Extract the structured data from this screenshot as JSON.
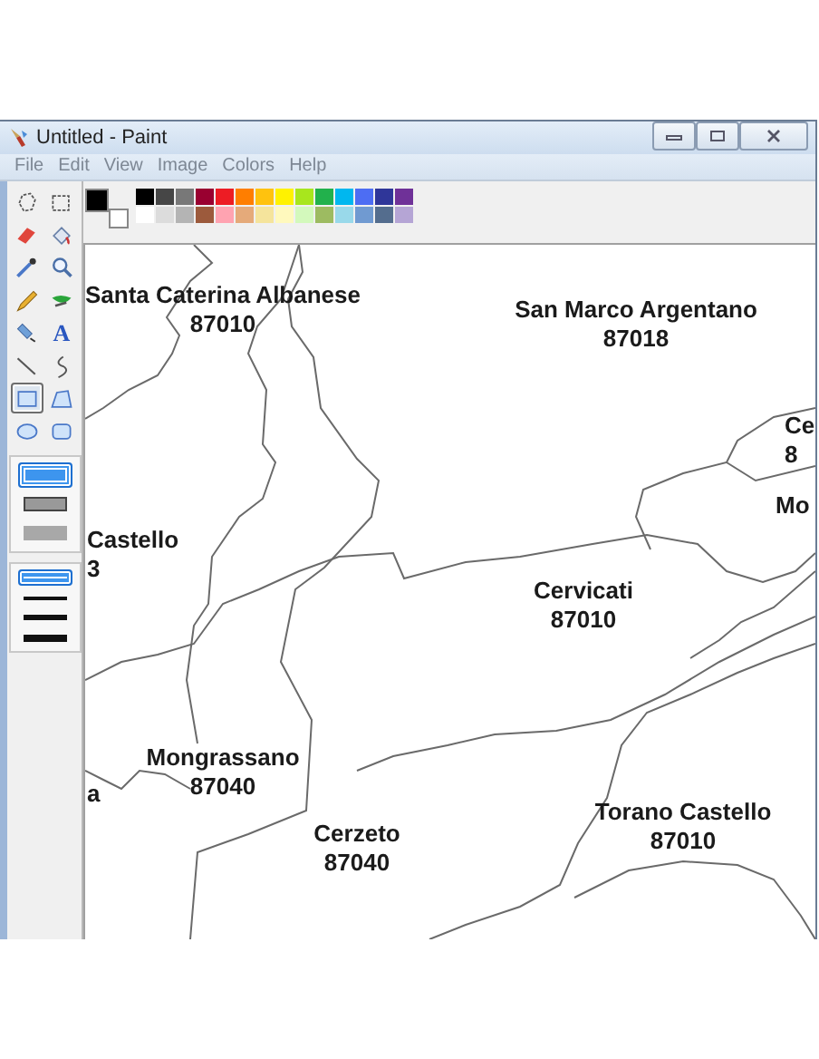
{
  "window": {
    "title": "Untitled - Paint"
  },
  "menu": [
    "File",
    "Edit",
    "View",
    "Image",
    "Colors",
    "Help"
  ],
  "tools": [
    {
      "kind": "free-select",
      "selected": false
    },
    {
      "kind": "select",
      "selected": false
    },
    {
      "kind": "eraser",
      "selected": false
    },
    {
      "kind": "fill",
      "selected": false
    },
    {
      "kind": "picker",
      "selected": false
    },
    {
      "kind": "magnifier",
      "selected": false
    },
    {
      "kind": "pencil",
      "selected": false
    },
    {
      "kind": "brush",
      "selected": false
    },
    {
      "kind": "airbrush",
      "selected": false
    },
    {
      "kind": "text",
      "glyph": "A",
      "selected": false
    },
    {
      "kind": "line",
      "selected": false
    },
    {
      "kind": "curve",
      "selected": false
    },
    {
      "kind": "rectangle",
      "selected": true
    },
    {
      "kind": "polygon",
      "selected": false
    },
    {
      "kind": "ellipse",
      "selected": false
    },
    {
      "kind": "rounded-rectangle",
      "selected": false
    }
  ],
  "fill_styles": [
    {
      "kind": "outline",
      "selected": true
    },
    {
      "kind": "outline-fill",
      "selected": false
    },
    {
      "kind": "fill",
      "selected": false
    }
  ],
  "line_widths": [
    {
      "kind": "thin",
      "selected": true
    },
    {
      "kind": "medium",
      "selected": false
    },
    {
      "kind": "thick",
      "selected": false
    },
    {
      "kind": "heavy",
      "selected": false
    }
  ],
  "current_colors": [
    {
      "kind": "foreground",
      "color": "#000000"
    },
    {
      "kind": "background",
      "color": "#ffffff"
    }
  ],
  "palette": [
    {
      "color": "#000000"
    },
    {
      "color": "#464646"
    },
    {
      "color": "#787878"
    },
    {
      "color": "#990030"
    },
    {
      "color": "#ed1c24"
    },
    {
      "color": "#ff7e00"
    },
    {
      "color": "#ffc20e"
    },
    {
      "color": "#fff200"
    },
    {
      "color": "#a8e61d"
    },
    {
      "color": "#22b14c"
    },
    {
      "color": "#00b7ef"
    },
    {
      "color": "#4d6df3"
    },
    {
      "color": "#2f3699"
    },
    {
      "color": "#6f3198"
    },
    {
      "color": "#ffffff"
    },
    {
      "color": "#dcdcdc"
    },
    {
      "color": "#b4b4b4"
    },
    {
      "color": "#9c5a3c"
    },
    {
      "color": "#ffa3b1"
    },
    {
      "color": "#e5aa7a"
    },
    {
      "color": "#f5e49c"
    },
    {
      "color": "#fff9bd"
    },
    {
      "color": "#d3f9bc"
    },
    {
      "color": "#9dbb61"
    },
    {
      "color": "#99d9ea"
    },
    {
      "color": "#709ad1"
    },
    {
      "color": "#546d8e"
    },
    {
      "color": "#b5a5d5"
    }
  ],
  "map_labels": [
    {
      "name": "Santa Caterina Albanese",
      "code": "87010"
    },
    {
      "name": "San Marco Argentano",
      "code": "87018"
    },
    {
      "name": "Ce",
      "code": "8"
    },
    {
      "name": "Mo"
    },
    {
      "name": "Castello",
      "code": "3"
    },
    {
      "name": "Cervicati",
      "code": "87010"
    },
    {
      "name": "Mongrassano",
      "code": "87040"
    },
    {
      "name": "a"
    },
    {
      "name": "Cerzeto",
      "code": "87040"
    },
    {
      "name": "Torano Castello",
      "code": "87010"
    }
  ]
}
